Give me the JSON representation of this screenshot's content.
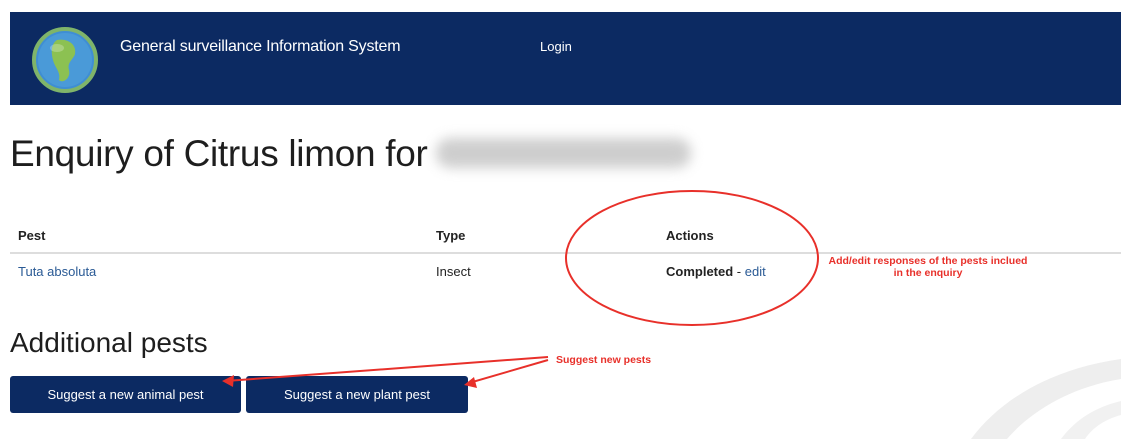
{
  "navbar": {
    "brand": "General surveillance Information System",
    "login_label": "Login",
    "logo_icon": "globe-icon",
    "bg_color": "#0c2a62"
  },
  "page": {
    "title": "Enquiry of Citrus limon for"
  },
  "table": {
    "headers": {
      "pest": "Pest",
      "type": "Type",
      "actions": "Actions"
    },
    "rows": [
      {
        "pest": "Tuta absoluta",
        "type": "Insect",
        "status": "Completed",
        "separator": " - ",
        "edit_label": "edit"
      }
    ]
  },
  "additional": {
    "title": "Additional pests",
    "animal_button": "Suggest a new animal pest",
    "plant_button": "Suggest a new plant pest"
  },
  "annotations": {
    "actions_note": "Add/edit responses of the pests inclued in the enquiry",
    "suggest_note": "Suggest new pests",
    "color": "#e8302a"
  }
}
